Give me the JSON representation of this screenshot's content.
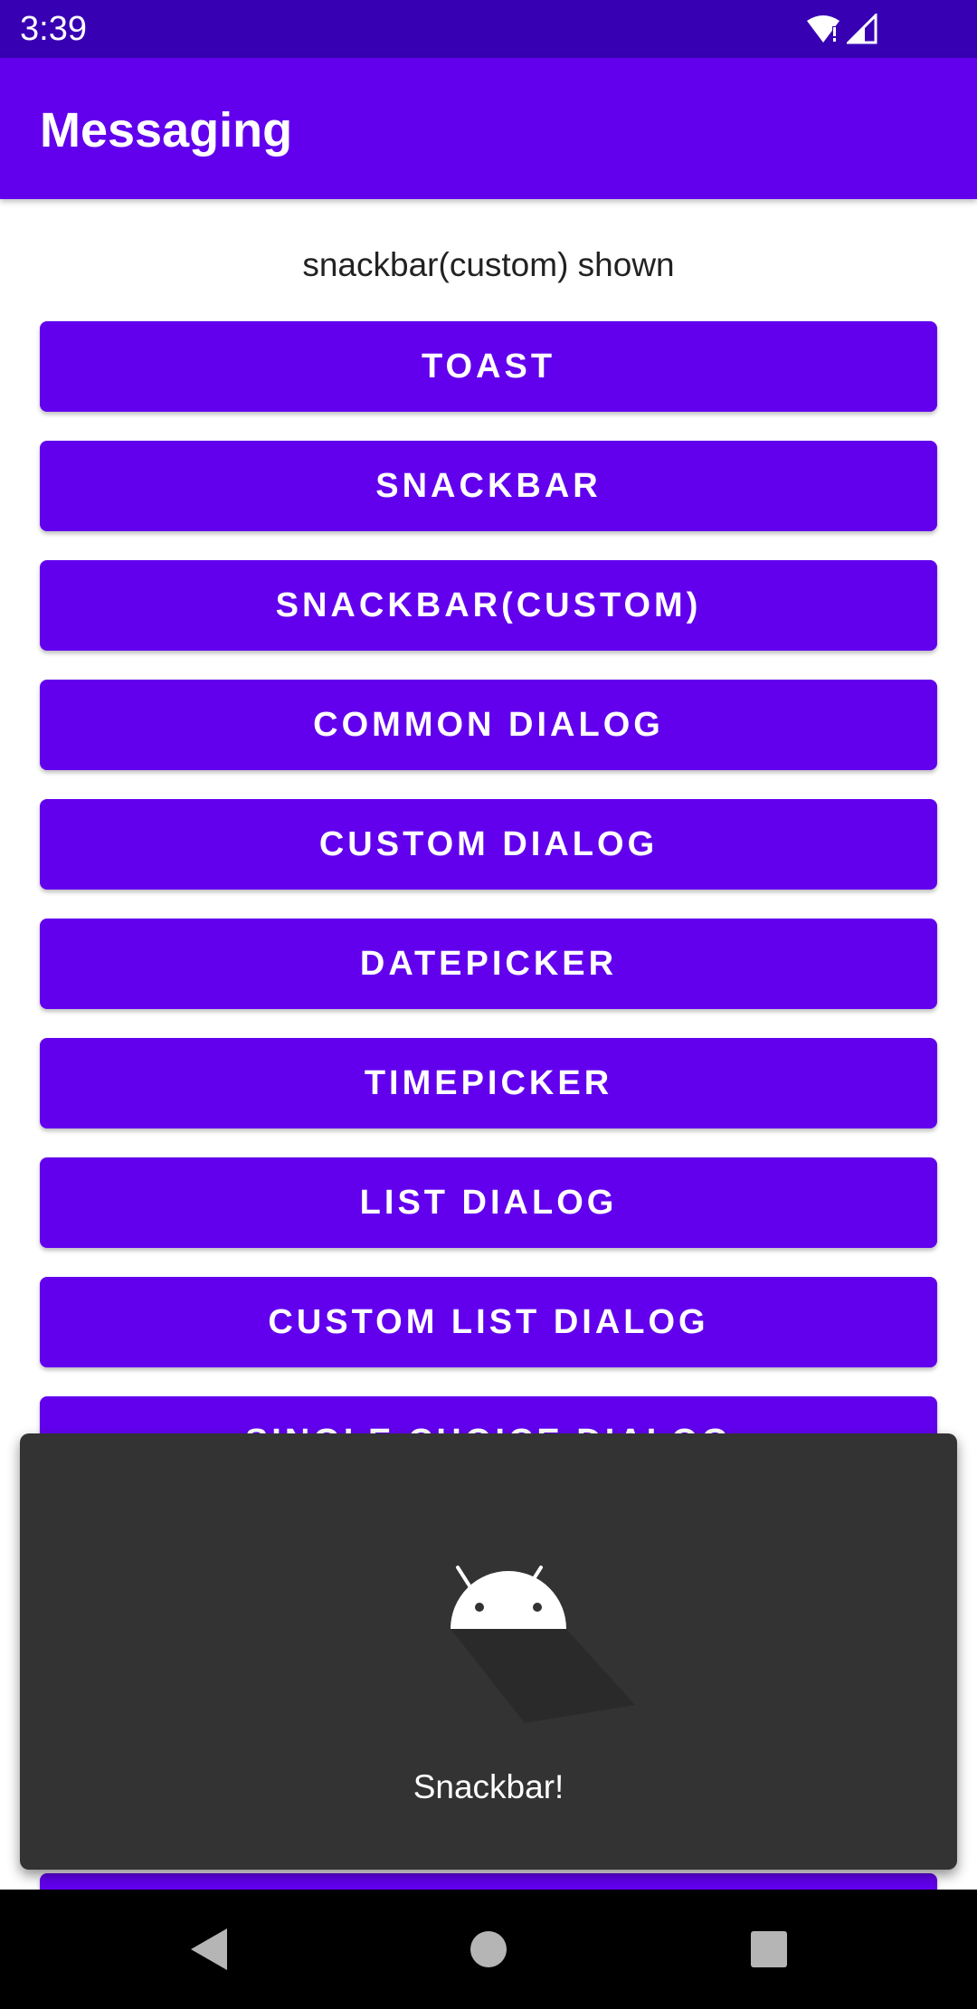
{
  "status_bar": {
    "time": "3:39",
    "icons": [
      "wifi-icon",
      "signal-icon"
    ]
  },
  "app_bar": {
    "title": "Messaging"
  },
  "main": {
    "status_text": "snackbar(custom) shown",
    "buttons": [
      {
        "label": "TOAST"
      },
      {
        "label": "SNACKBAR"
      },
      {
        "label": "SNACKBAR(CUSTOM)"
      },
      {
        "label": "COMMON DIALOG"
      },
      {
        "label": "CUSTOM DIALOG"
      },
      {
        "label": "DATEPICKER"
      },
      {
        "label": "TIMEPICKER"
      },
      {
        "label": "LIST DIALOG"
      },
      {
        "label": "CUSTOM LIST DIALOG"
      },
      {
        "label": "SINGLE CHOICE DIALOG"
      },
      {
        "label": ""
      }
    ]
  },
  "snackbar": {
    "icon": "android-icon",
    "message": "Snackbar!"
  },
  "nav_bar": {
    "icons": [
      "back-icon",
      "home-icon",
      "recents-icon"
    ]
  },
  "colors": {
    "status_bar": "#3700B3",
    "primary": "#6200EE",
    "snackbar": "#333333",
    "nav_bar": "#000000"
  }
}
